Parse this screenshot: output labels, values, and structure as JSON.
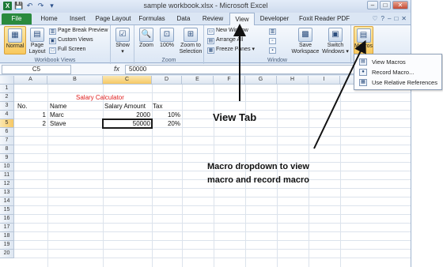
{
  "window": {
    "title": "sample workbook.xlsx - Microsoft Excel",
    "controls": [
      "–",
      "□",
      "✕"
    ]
  },
  "quick_access": [
    "X",
    "💾",
    "↶",
    "↷",
    "▾"
  ],
  "tabs": {
    "file": "File",
    "items": [
      "Home",
      "Insert",
      "Page Layout",
      "Formulas",
      "Data",
      "Review",
      "View",
      "Developer",
      "Foxit Reader PDF"
    ],
    "active": "View",
    "right_icons": [
      "♡",
      "?",
      "–",
      "□",
      "✕"
    ]
  },
  "ribbon": {
    "workbook_views": {
      "label": "Workbook Views",
      "normal": "Normal",
      "page_layout_1": "Page",
      "page_layout_2": "Layout",
      "page_break": "Page Break Preview",
      "custom_views": "Custom Views",
      "full_screen": "Full Screen"
    },
    "show": {
      "label": "Show"
    },
    "zoom_group": {
      "label": "Zoom",
      "zoom": "Zoom",
      "hundred": "100%",
      "zoom_sel_1": "Zoom to",
      "zoom_sel_2": "Selection"
    },
    "window_group": {
      "label": "Window",
      "new_window": "New Window",
      "arrange_all": "Arrange All",
      "freeze_panes": "Freeze Panes",
      "save_ws_1": "Save",
      "save_ws_2": "Workspace",
      "switch_1": "Switch",
      "switch_2": "Windows"
    },
    "macros_group": {
      "macros": "Macros"
    }
  },
  "formula_bar": {
    "name_box": "C5",
    "fx": "fx",
    "content": "50000"
  },
  "columns": [
    "A",
    "B",
    "C",
    "D",
    "E",
    "F",
    "G",
    "H",
    "I"
  ],
  "rows": [
    "1",
    "2",
    "3",
    "4",
    "5",
    "6",
    "7",
    "8",
    "9",
    "10",
    "11",
    "12",
    "13",
    "14",
    "15",
    "16",
    "17",
    "18",
    "19",
    "20"
  ],
  "sheet": {
    "title": "Salary Calculator",
    "headers": {
      "no": "No.",
      "name": "Name",
      "salary": "Salary Amount",
      "tax": "Tax"
    },
    "records": [
      {
        "no": "1",
        "name": "Marc",
        "salary": "2000",
        "tax": "10%"
      },
      {
        "no": "2",
        "name": "Stave",
        "salary": "50000",
        "tax": "20%"
      }
    ],
    "title_color": "#e02020"
  },
  "macros_menu": {
    "view_macros": "View Macros",
    "record_macro": "Record Macro...",
    "use_relative": "Use Relative References"
  },
  "annotations": {
    "view_tab": "View Tab",
    "macro_line1": "Macro dropdown to view",
    "macro_line2": "macro and record macro"
  },
  "colors": {
    "file_tab": "#2a8a3e",
    "selection": "#f8c95e",
    "ribbon": "#dce7f5"
  }
}
